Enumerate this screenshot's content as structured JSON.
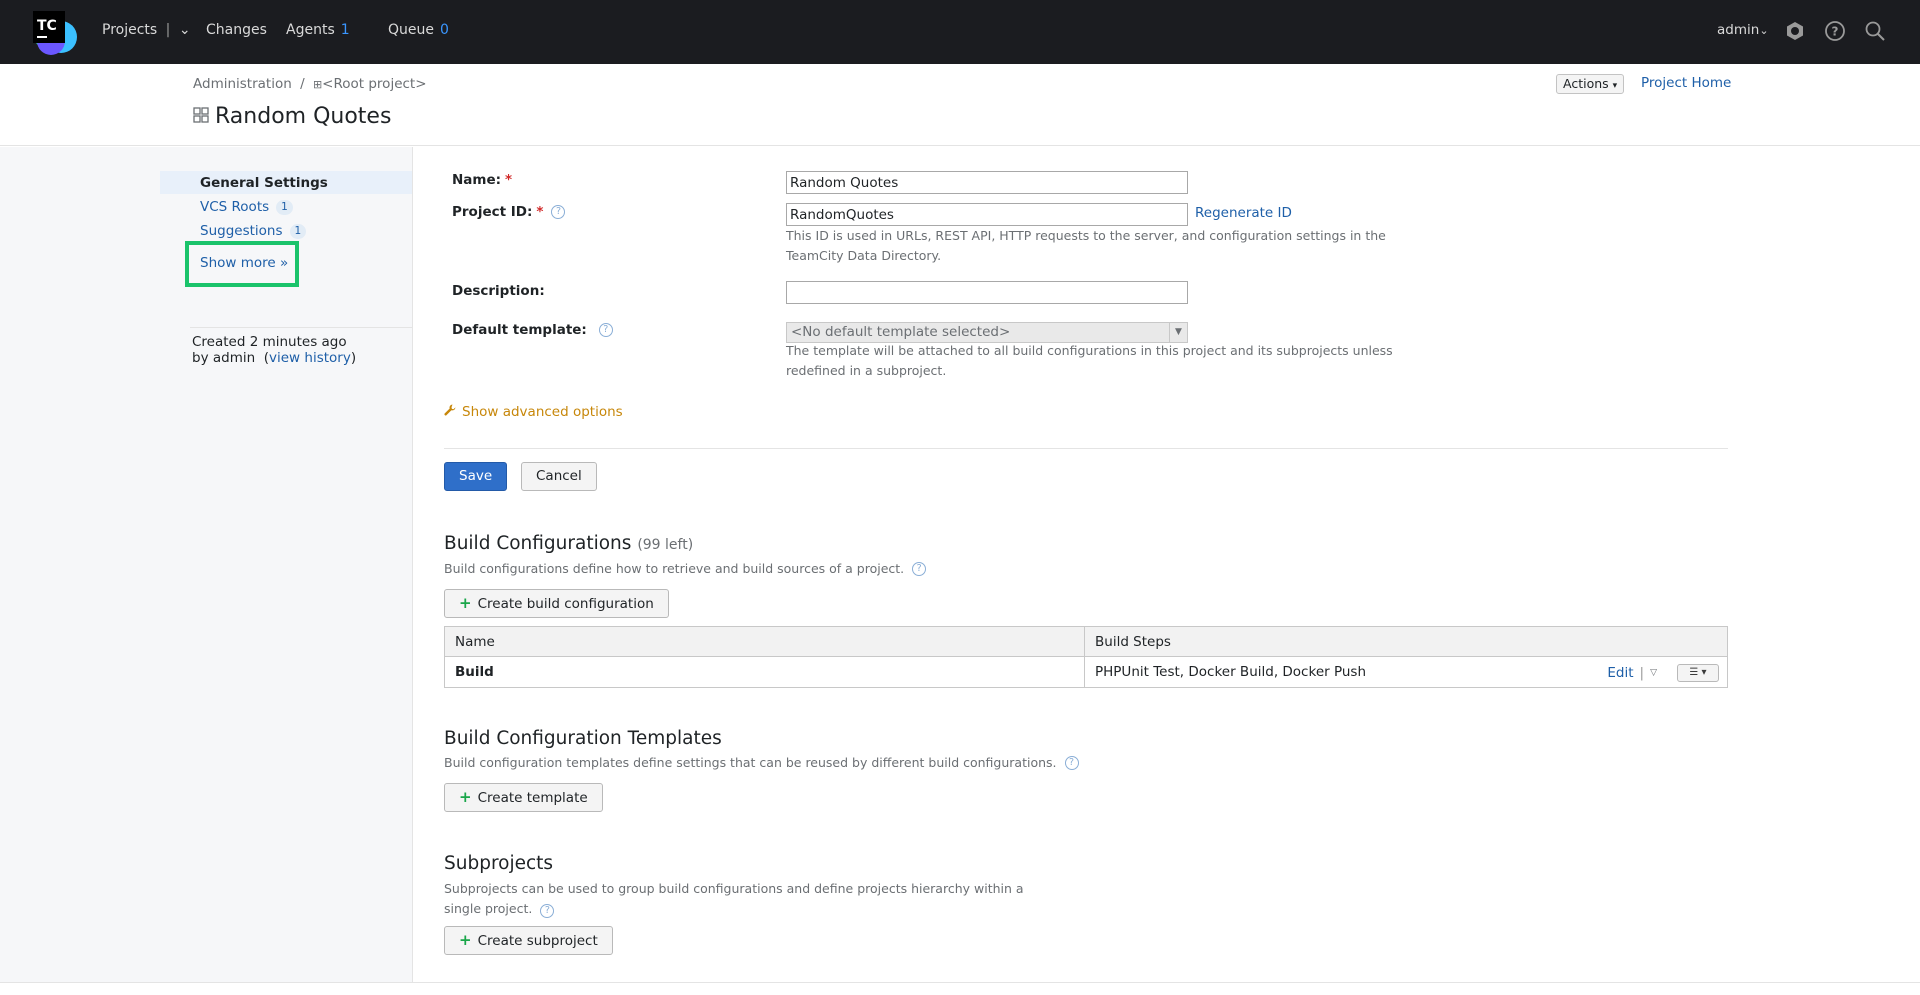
{
  "nav": {
    "projects": "Projects",
    "changes": "Changes",
    "agents": "Agents",
    "agents_count": "1",
    "queue": "Queue",
    "queue_count": "0",
    "user": "admin",
    "logo_text": "TC"
  },
  "header": {
    "breadcrumb_admin": "Administration",
    "breadcrumb_sep": "/",
    "breadcrumb_root": "<Root project>",
    "title": "Random Quotes",
    "actions_label": "Actions",
    "project_home": "Project Home"
  },
  "sidebar": {
    "items": [
      {
        "label": "General Settings"
      },
      {
        "label": "VCS Roots",
        "count": "1"
      },
      {
        "label": "Suggestions",
        "count": "1"
      },
      {
        "label": "Show more »"
      }
    ],
    "created_line": "Created 2 minutes ago",
    "by_line": "by admin",
    "view_history": "view history"
  },
  "form": {
    "name_label": "Name:",
    "name_value": "Random Quotes",
    "id_label": "Project ID:",
    "id_value": "RandomQuotes",
    "regenerate": "Regenerate ID",
    "id_hint": "This ID is used in URLs, REST API, HTTP requests to the server, and configuration settings in the TeamCity Data Directory.",
    "description_label": "Description:",
    "description_value": "",
    "template_label": "Default template:",
    "template_value": "<No default template selected>",
    "template_hint": "The template will be attached to all build configurations in this project and its subprojects unless redefined in a subproject.",
    "advanced": "Show advanced options",
    "save": "Save",
    "cancel": "Cancel",
    "required_mark": "*",
    "help_glyph": "?"
  },
  "build_configs": {
    "title": "Build Configurations",
    "left": "(99 left)",
    "desc": "Build configurations define how to retrieve and build sources of a project.",
    "create": "Create build configuration",
    "columns": [
      "Name",
      "Build Steps"
    ],
    "rows": [
      {
        "name": "Build",
        "steps": "PHPUnit Test, Docker Build, Docker Push",
        "edit": "Edit"
      }
    ]
  },
  "templates": {
    "title": "Build Configuration Templates",
    "desc": "Build configuration templates define settings that can be reused by different build configurations.",
    "create": "Create template"
  },
  "subprojects": {
    "title": "Subprojects",
    "desc": "Subprojects can be used to group build configurations and define projects hierarchy within a single project.",
    "create": "Create subproject"
  },
  "colors": {
    "topbar": "#1b1c20",
    "link": "#1e5fa8",
    "highlight": "#1ac36b",
    "primary": "#2f6fc9"
  }
}
